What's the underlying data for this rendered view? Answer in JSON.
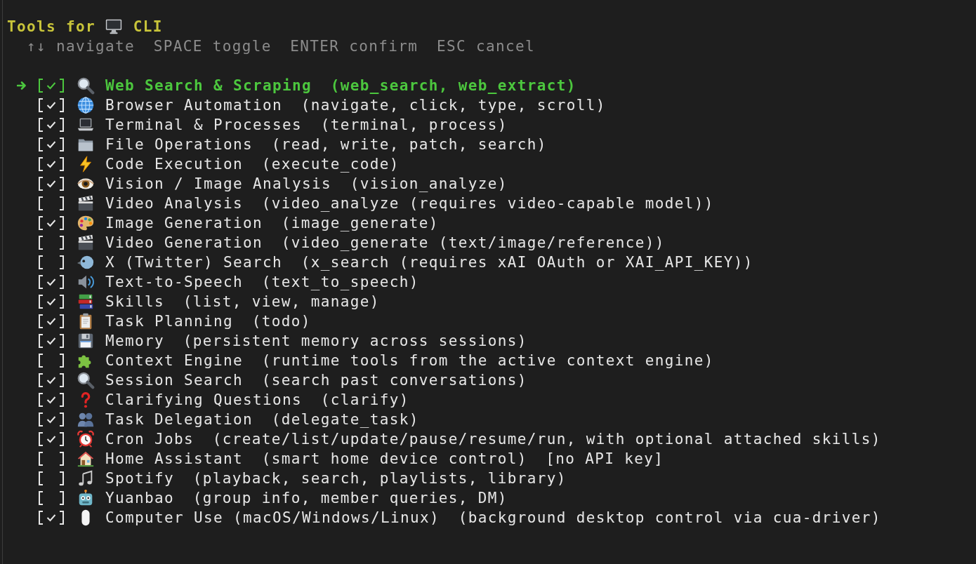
{
  "header": {
    "title": "Tools for",
    "target": "CLI"
  },
  "hints": [
    "↑↓ navigate",
    "SPACE toggle",
    "ENTER confirm",
    "ESC cancel"
  ],
  "tools": [
    {
      "name": "Web Search & Scraping",
      "detail": "(web_search, web_extract)",
      "checked": true,
      "selected": true
    },
    {
      "name": "Browser Automation",
      "detail": "(navigate, click, type, scroll)",
      "checked": true,
      "selected": false
    },
    {
      "name": "Terminal & Processes",
      "detail": "(terminal, process)",
      "checked": true,
      "selected": false
    },
    {
      "name": "File Operations",
      "detail": "(read, write, patch, search)",
      "checked": true,
      "selected": false
    },
    {
      "name": "Code Execution",
      "detail": "(execute_code)",
      "checked": true,
      "selected": false
    },
    {
      "name": "Vision / Image Analysis",
      "detail": "(vision_analyze)",
      "checked": true,
      "selected": false
    },
    {
      "name": "Video Analysis",
      "detail": "(video_analyze (requires video-capable model))",
      "checked": false,
      "selected": false
    },
    {
      "name": "Image Generation",
      "detail": "(image_generate)",
      "checked": true,
      "selected": false
    },
    {
      "name": "Video Generation",
      "detail": "(video_generate (text/image/reference))",
      "checked": false,
      "selected": false
    },
    {
      "name": "X (Twitter) Search",
      "detail": "(x_search (requires xAI OAuth or XAI_API_KEY))",
      "checked": false,
      "selected": false
    },
    {
      "name": "Text-to-Speech",
      "detail": "(text_to_speech)",
      "checked": true,
      "selected": false
    },
    {
      "name": "Skills",
      "detail": "(list, view, manage)",
      "checked": true,
      "selected": false
    },
    {
      "name": "Task Planning",
      "detail": "(todo)",
      "checked": true,
      "selected": false
    },
    {
      "name": "Memory",
      "detail": "(persistent memory across sessions)",
      "checked": true,
      "selected": false
    },
    {
      "name": "Context Engine",
      "detail": "(runtime tools from the active context engine)",
      "checked": false,
      "selected": false
    },
    {
      "name": "Session Search",
      "detail": "(search past conversations)",
      "checked": true,
      "selected": false
    },
    {
      "name": "Clarifying Questions",
      "detail": "(clarify)",
      "checked": true,
      "selected": false
    },
    {
      "name": "Task Delegation",
      "detail": "(delegate_task)",
      "checked": true,
      "selected": false
    },
    {
      "name": "Cron Jobs",
      "detail": "(create/list/update/pause/resume/run, with optional attached skills)",
      "checked": true,
      "selected": false
    },
    {
      "name": "Home Assistant",
      "detail": "(smart home device control)",
      "note": "[no API key]",
      "checked": false,
      "selected": false
    },
    {
      "name": "Spotify",
      "detail": "(playback, search, playlists, library)",
      "checked": false,
      "selected": false
    },
    {
      "name": "Yuanbao",
      "detail": "(group info, member queries, DM)",
      "checked": false,
      "selected": false
    },
    {
      "name": "Computer Use (macOS/Windows/Linux)",
      "detail": "(background desktop control via cua-driver)",
      "checked": true,
      "selected": false
    }
  ]
}
